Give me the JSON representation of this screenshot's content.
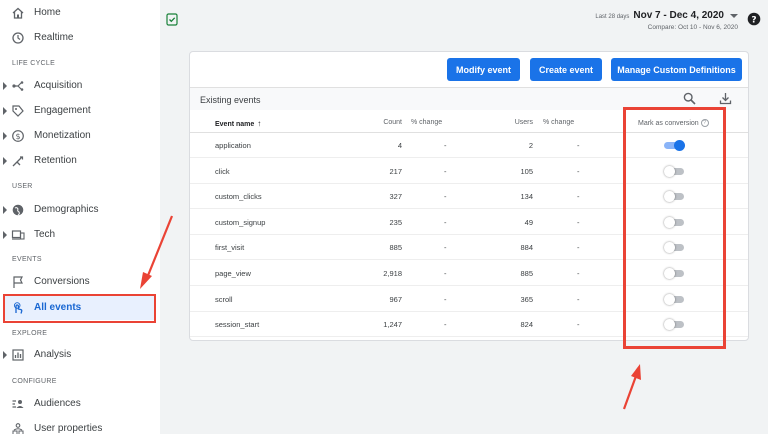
{
  "sidebar": {
    "items_top": [
      {
        "label": "Home",
        "icon": "home-icon"
      },
      {
        "label": "Realtime",
        "icon": "clock-icon"
      }
    ],
    "sections": {
      "life_cycle": "LIFE CYCLE",
      "user": "USER",
      "events": "EVENTS",
      "explore": "EXPLORE",
      "configure": "CONFIGURE"
    },
    "life_cycle_items": [
      {
        "label": "Acquisition",
        "icon": "acquisition-icon"
      },
      {
        "label": "Engagement",
        "icon": "engagement-icon"
      },
      {
        "label": "Monetization",
        "icon": "monetization-icon"
      },
      {
        "label": "Retention",
        "icon": "retention-icon"
      }
    ],
    "user_items": [
      {
        "label": "Demographics",
        "icon": "globe-icon"
      },
      {
        "label": "Tech",
        "icon": "devices-icon"
      }
    ],
    "events_items": [
      {
        "label": "Conversions",
        "icon": "flag-icon"
      },
      {
        "label": "All events",
        "icon": "touch-icon",
        "active": true
      }
    ],
    "explore_items": [
      {
        "label": "Analysis",
        "icon": "analysis-icon"
      }
    ],
    "configure_items": [
      {
        "label": "Audiences",
        "icon": "audiences-icon"
      },
      {
        "label": "User properties",
        "icon": "user-properties-icon"
      }
    ]
  },
  "header": {
    "period_label": "Last 28 days",
    "date_range": "Nov 7 - Dec 4, 2020",
    "compare_label": "Compare: Oct 10 - Nov 6, 2020"
  },
  "buttons": {
    "modify_event": "Modify event",
    "create_event": "Create event",
    "manage_definitions": "Manage Custom Definitions"
  },
  "table": {
    "title": "Existing events",
    "columns": {
      "event_name": "Event name",
      "count": "Count",
      "count_change": "% change",
      "users": "Users",
      "users_change": "% change",
      "conversion": "Mark as conversion"
    },
    "rows": [
      {
        "name": "application",
        "count": "4",
        "count_change": "-",
        "users": "2",
        "users_change": "-",
        "conversion": true
      },
      {
        "name": "click",
        "count": "217",
        "count_change": "-",
        "users": "105",
        "users_change": "-",
        "conversion": false
      },
      {
        "name": "custom_clicks",
        "count": "327",
        "count_change": "-",
        "users": "134",
        "users_change": "-",
        "conversion": false
      },
      {
        "name": "custom_signup",
        "count": "235",
        "count_change": "-",
        "users": "49",
        "users_change": "-",
        "conversion": false
      },
      {
        "name": "first_visit",
        "count": "885",
        "count_change": "-",
        "users": "884",
        "users_change": "-",
        "conversion": false
      },
      {
        "name": "page_view",
        "count": "2,918",
        "count_change": "-",
        "users": "885",
        "users_change": "-",
        "conversion": false
      },
      {
        "name": "scroll",
        "count": "967",
        "count_change": "-",
        "users": "365",
        "users_change": "-",
        "conversion": false
      },
      {
        "name": "session_start",
        "count": "1,247",
        "count_change": "-",
        "users": "824",
        "users_change": "-",
        "conversion": false
      }
    ]
  },
  "colors": {
    "primary": "#1a73e8",
    "annotation": "#ea4335",
    "active_bg": "#e8f0fe"
  }
}
